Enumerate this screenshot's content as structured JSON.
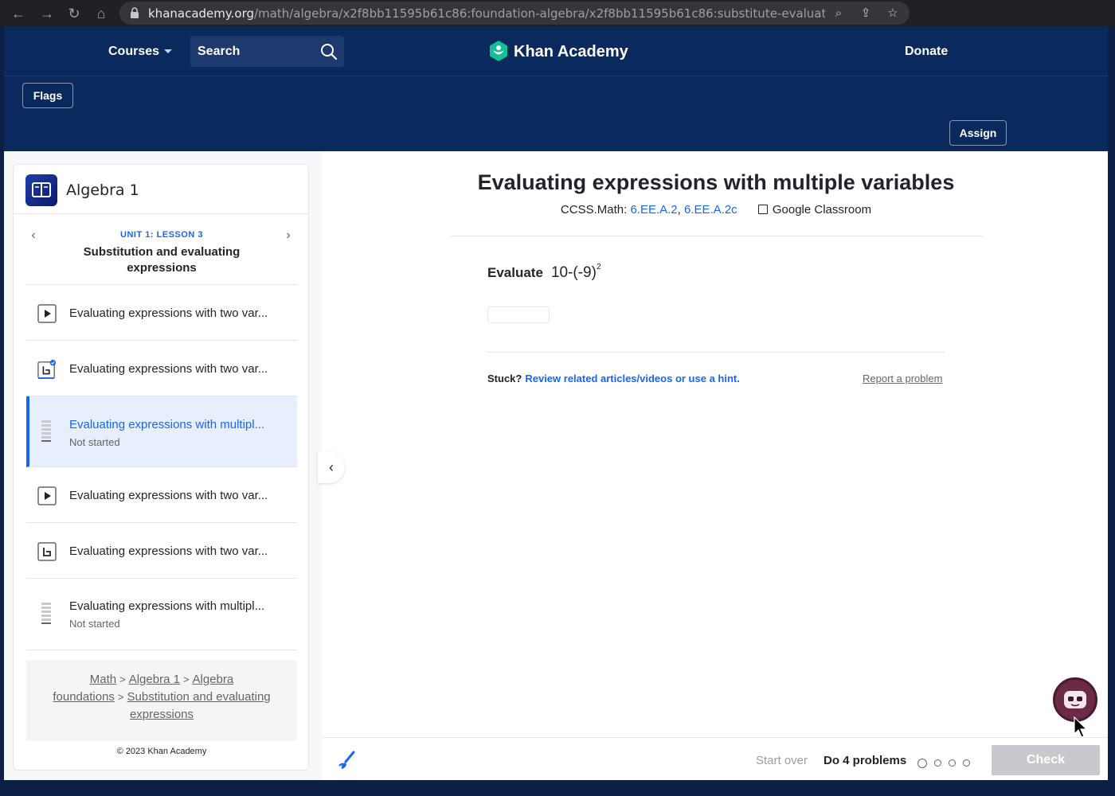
{
  "browser": {
    "url_host": "khanacademy.org",
    "url_path": "/math/algebra/x2f8bb11595b61c86:foundation-algebra/x2f8bb11595b61c86:substitute-evaluate-ex..."
  },
  "header": {
    "courses": "Courses",
    "search_label": "Search",
    "logo": "Khan Academy",
    "donate": "Donate",
    "flags": "Flags",
    "assign": "Assign"
  },
  "sidebar": {
    "course_title": "Algebra 1",
    "unit_label": "UNIT 1: LESSON 3",
    "lesson_title": "Substitution and evaluating expressions",
    "items": [
      {
        "title": "Evaluating expressions with two var...",
        "sub": "",
        "icon": "video-icon"
      },
      {
        "title": "Evaluating expressions with two var...",
        "sub": "",
        "icon": "article-complete-icon"
      },
      {
        "title": "Evaluating expressions with multipl...",
        "sub": "Not started",
        "icon": "exercise-icon"
      },
      {
        "title": "Evaluating expressions with two var...",
        "sub": "",
        "icon": "video-icon"
      },
      {
        "title": "Evaluating expressions with two var...",
        "sub": "",
        "icon": "article-icon"
      },
      {
        "title": "Evaluating expressions with multipl...",
        "sub": "Not started",
        "icon": "exercise-icon"
      }
    ],
    "breadcrumbs": [
      "Math",
      "Algebra 1",
      "Algebra foundations",
      "Substitution and evaluating expressions"
    ],
    "copyright": "© 2023 Khan Academy"
  },
  "exercise": {
    "title": "Evaluating expressions with multiple variables",
    "ccss_label": "CCSS.Math:",
    "ccss_link1": "6.EE.A.2",
    "ccss_link2": "6.EE.A.2c",
    "google_classroom": "Google Classroom",
    "prompt": "Evaluate",
    "expression": "10-(-9)",
    "exponent": "2",
    "stuck": "Stuck?",
    "hint_link": "Review related articles/videos or use a hint.",
    "report": "Report a problem"
  },
  "footer": {
    "start_over": "Start over",
    "do_problems": "Do 4 problems",
    "check": "Check"
  },
  "colors": {
    "header_bg": "#0a2a5e",
    "accent": "#1865f2",
    "logo_green": "#14bf96"
  }
}
